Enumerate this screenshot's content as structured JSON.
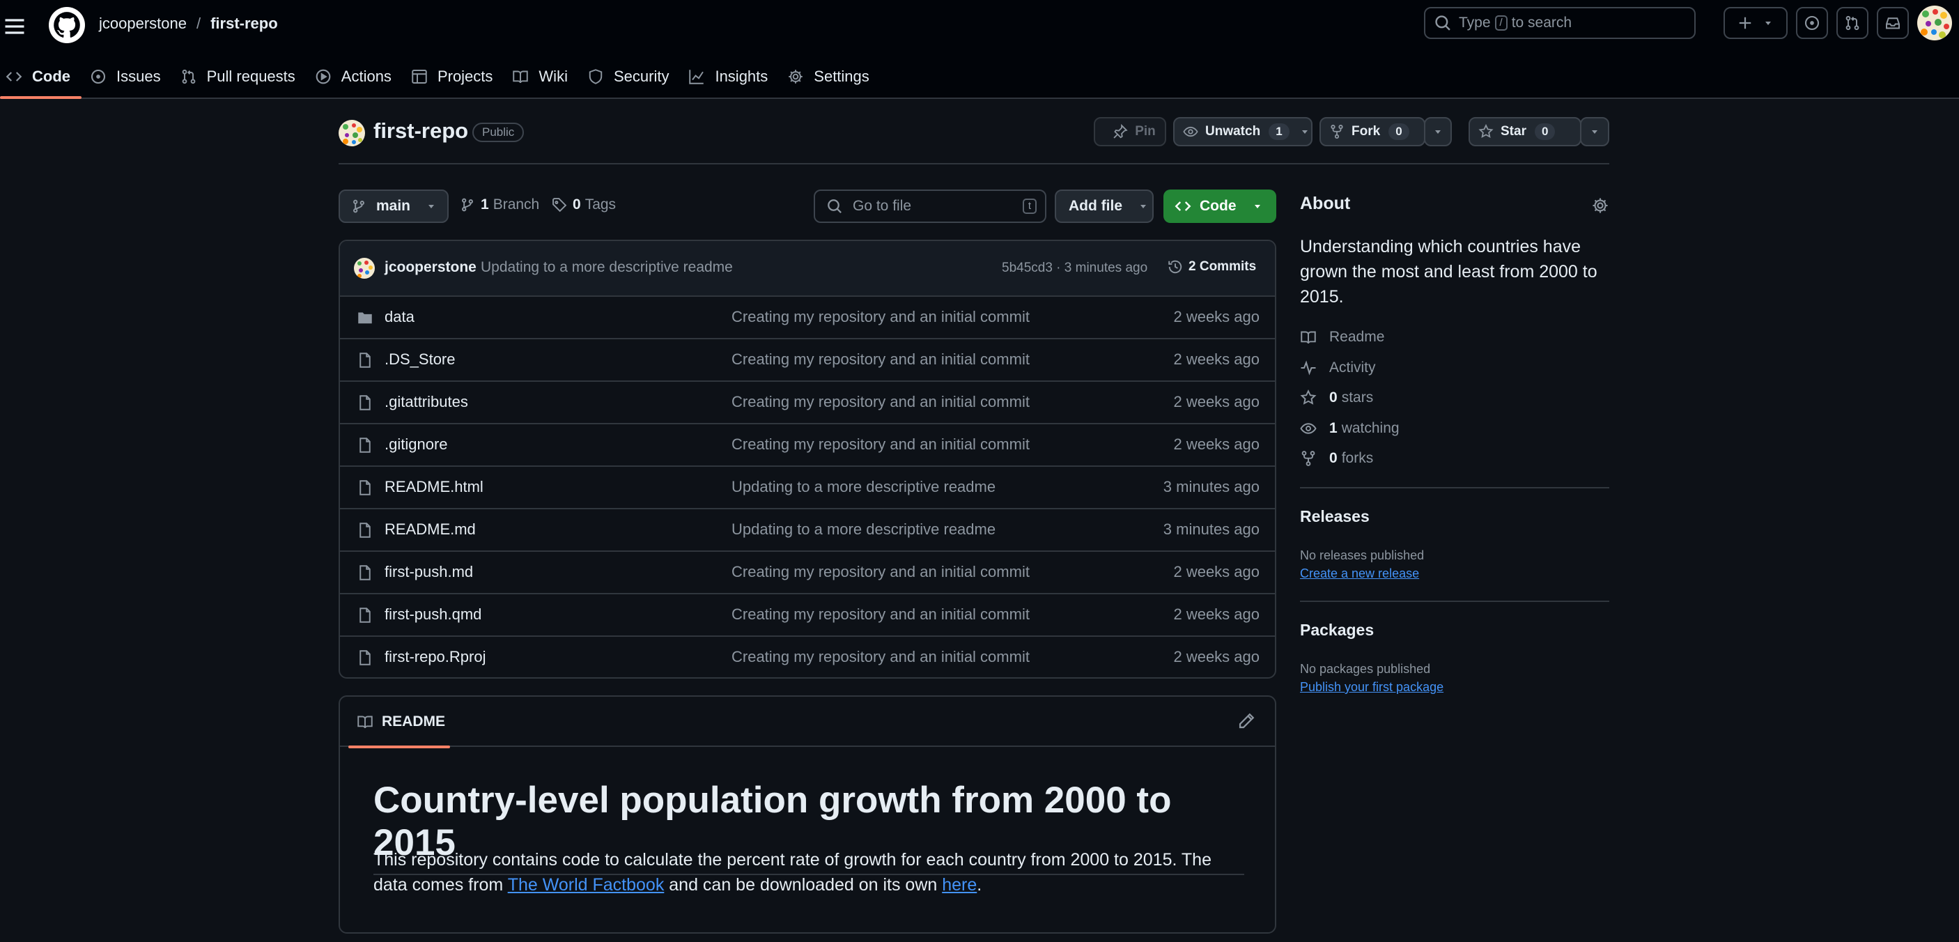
{
  "header": {
    "owner": "jcooperstone",
    "separator": "/",
    "repo": "first-repo",
    "search_prefix": "Type",
    "search_key": "/",
    "search_suffix": "to search"
  },
  "nav": {
    "tabs": [
      {
        "label": "Code",
        "icon": "code-icon"
      },
      {
        "label": "Issues",
        "icon": "issue-icon"
      },
      {
        "label": "Pull requests",
        "icon": "pull-request-icon"
      },
      {
        "label": "Actions",
        "icon": "play-icon"
      },
      {
        "label": "Projects",
        "icon": "table-icon"
      },
      {
        "label": "Wiki",
        "icon": "book-icon"
      },
      {
        "label": "Security",
        "icon": "shield-icon"
      },
      {
        "label": "Insights",
        "icon": "graph-icon"
      },
      {
        "label": "Settings",
        "icon": "gear-icon"
      }
    ]
  },
  "repo": {
    "name": "first-repo",
    "visibility": "Public",
    "pin_label": "Pin",
    "watch_label": "Unwatch",
    "watch_count": "1",
    "fork_label": "Fork",
    "fork_count": "0",
    "star_label": "Star",
    "star_count": "0"
  },
  "branch": {
    "current": "main",
    "branch_count": "1",
    "branch_label": "Branch",
    "tag_count": "0",
    "tag_label": "Tags",
    "goto_placeholder": "Go to file",
    "goto_key": "t",
    "add_file_label": "Add file",
    "code_label": "Code"
  },
  "commit": {
    "author": "jcooperstone",
    "message": "Updating to a more descriptive readme",
    "meta": "5b45cd3 · 3 minutes ago",
    "commits_label": "2 Commits"
  },
  "files": [
    {
      "name": "data",
      "type": "dir",
      "message": "Creating my repository and an initial commit",
      "age": "2 weeks ago"
    },
    {
      "name": ".DS_Store",
      "type": "file",
      "message": "Creating my repository and an initial commit",
      "age": "2 weeks ago"
    },
    {
      "name": ".gitattributes",
      "type": "file",
      "message": "Creating my repository and an initial commit",
      "age": "2 weeks ago"
    },
    {
      "name": ".gitignore",
      "type": "file",
      "message": "Creating my repository and an initial commit",
      "age": "2 weeks ago"
    },
    {
      "name": "README.html",
      "type": "file",
      "message": "Updating to a more descriptive readme",
      "age": "3 minutes ago"
    },
    {
      "name": "README.md",
      "type": "file",
      "message": "Updating to a more descriptive readme",
      "age": "3 minutes ago"
    },
    {
      "name": "first-push.md",
      "type": "file",
      "message": "Creating my repository and an initial commit",
      "age": "2 weeks ago"
    },
    {
      "name": "first-push.qmd",
      "type": "file",
      "message": "Creating my repository and an initial commit",
      "age": "2 weeks ago"
    },
    {
      "name": "first-repo.Rproj",
      "type": "file",
      "message": "Creating my repository and an initial commit",
      "age": "2 weeks ago"
    }
  ],
  "readme": {
    "tab_label": "README",
    "heading": "Country-level population growth from 2000 to 2015",
    "p_part1": "This repository contains code to calculate the percent rate of growth for each country from 2000 to 2015. The data comes from ",
    "link1": "The World Factbook",
    "p_part2": " and can be downloaded on its own ",
    "link2": "here",
    "p_part3": "."
  },
  "about": {
    "title": "About",
    "description": "Understanding which countries have grown the most and least from 2000 to 2015.",
    "readme_label": "Readme",
    "activity_label": "Activity",
    "stars_count": "0",
    "stars_label": "stars",
    "watching_count": "1",
    "watching_label": "watching",
    "forks_count": "0",
    "forks_label": "forks"
  },
  "releases": {
    "title": "Releases",
    "note": "No releases published",
    "link": "Create a new release"
  },
  "packages": {
    "title": "Packages",
    "note": "No packages published",
    "link": "Publish your first package"
  },
  "colors": {
    "background": "#0d1117",
    "header_bg": "#010409",
    "border": "#30363d",
    "accent_tab": "#f78166",
    "code_button": "#238636",
    "link": "#4493f8",
    "muted_text": "#8d96a0"
  }
}
